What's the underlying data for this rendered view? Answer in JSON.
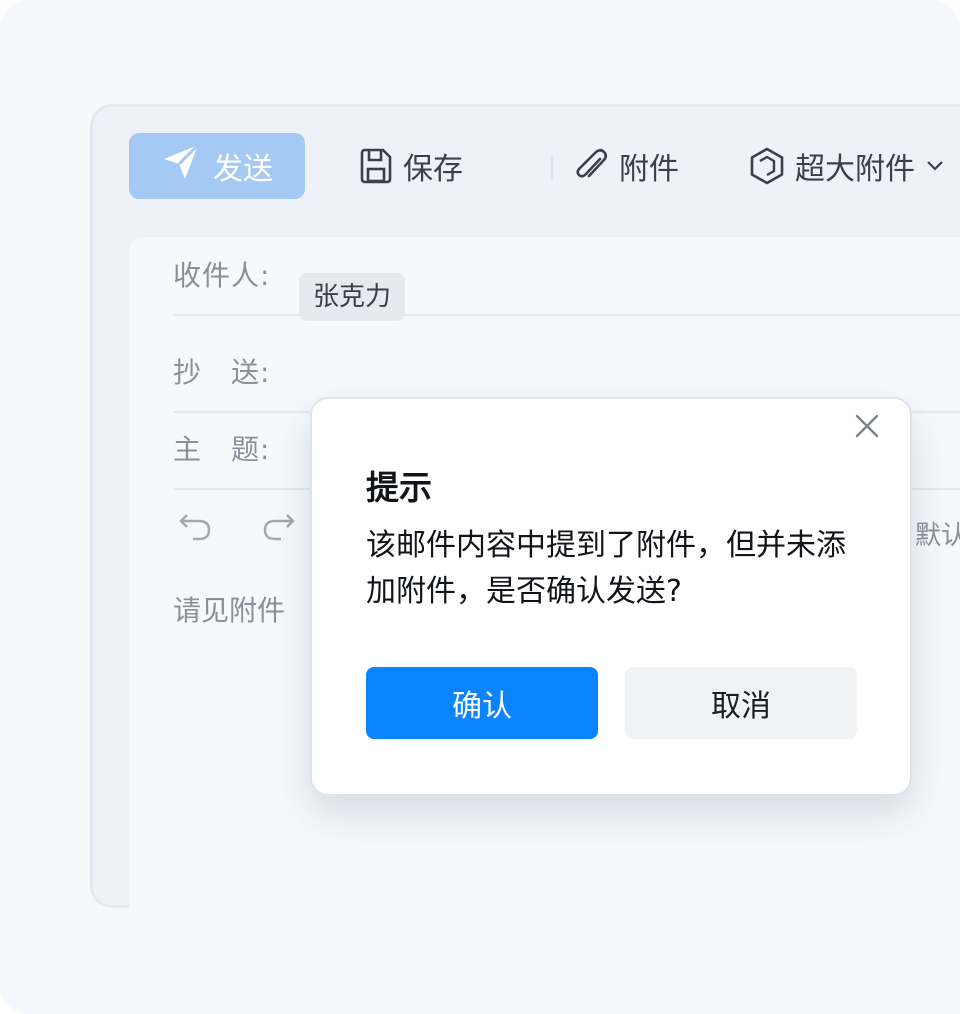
{
  "toolbar": {
    "send_label": "发送",
    "save_label": "保存",
    "attach_label": "附件",
    "large_attach_label": "超大附件"
  },
  "compose": {
    "to_label": "收件人:",
    "to_recipient": "张克力",
    "cc_label": "抄　送:",
    "subject_label": "主　题:",
    "default_text": "默认",
    "body": "请见附件"
  },
  "dialog": {
    "title": "提示",
    "message": "该邮件内容中提到了附件，但并未添加附件，是否确认发送?",
    "confirm_label": "确认",
    "cancel_label": "取消"
  },
  "colors": {
    "primary": "#0a84ff",
    "send_button_disabled": "#a3c9f4"
  },
  "icons": [
    "send-icon",
    "save-icon",
    "paperclip-icon",
    "large-attachment-icon",
    "chevron-down-icon",
    "undo-icon",
    "redo-icon",
    "close-icon"
  ]
}
